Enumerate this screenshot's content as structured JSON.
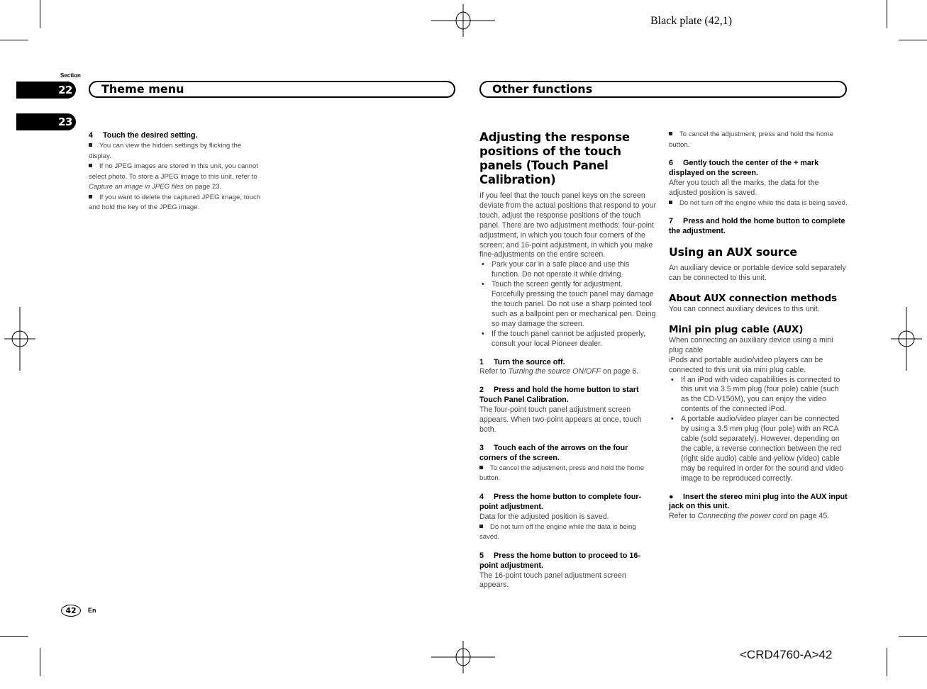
{
  "header": {
    "plate": "Black plate (42,1)"
  },
  "footer": {
    "doc_id": "<CRD4760-A>42",
    "page_number": "42",
    "language": "En"
  },
  "sections": {
    "label": "Section",
    "tabs": [
      {
        "number": "22",
        "active": true
      },
      {
        "number": "23",
        "active": false
      }
    ]
  },
  "chapters": {
    "left": "Theme menu",
    "right": "Other functions"
  },
  "left_column": {
    "step": {
      "num": "4",
      "title": "Touch the desired setting."
    },
    "notes": [
      "You can view the hidden settings by flicking the display.",
      {
        "pre": "If no JPEG images are stored in this unit, you cannot select photo. To store a JPEG image to this unit, refer to ",
        "ref": "Capture an image in JPEG files",
        "post": " on page 23."
      },
      "If you want to delete the captured JPEG image, touch and hold the key of the JPEG image."
    ]
  },
  "middle_column": {
    "title": "Adjusting the response positions of the touch panels (Touch Panel Calibration)",
    "intro": "If you feel that the touch panel keys on the screen deviate from the actual positions that respond to your touch, adjust the response positions of the touch panel. There are two adjustment methods: four-point adjustment, in which you touch four corners of the screen; and 16-point adjustment, in which you make fine-adjustments on the entire screen.",
    "bullets": [
      "Park your car in a safe place and use this function. Do not operate it while driving.",
      "Touch the screen gently for adjustment. Forcefully pressing the touch panel may damage the touch panel. Do not use a sharp pointed tool such as a ballpoint pen or mechanical pen. Doing so may damage the screen.",
      "If the touch panel cannot be adjusted properly, consult your local Pioneer dealer."
    ],
    "steps": [
      {
        "num": "1",
        "title": "Turn the source off.",
        "ref_pre": "Refer to ",
        "ref": "Turning the source ON/OFF",
        "ref_post": " on page 6."
      },
      {
        "num": "2",
        "title": "Press and hold the home button to start Touch Panel Calibration.",
        "body": "The four-point touch panel adjustment screen appears. When two-point appears at once, touch both."
      },
      {
        "num": "3",
        "title": "Touch each of the arrows on the four corners of the screen.",
        "note": "To cancel the adjustment, press and hold the home button."
      },
      {
        "num": "4",
        "title": "Press the home button to complete four-point adjustment.",
        "body": "Data for the adjusted position is saved.",
        "note": "Do not turn off the engine while the data is being saved."
      },
      {
        "num": "5",
        "title": "Press the home button to proceed to 16-point adjustment.",
        "body": "The 16-point touch panel adjustment screen appears."
      }
    ]
  },
  "right_column": {
    "top_note": "To cancel the adjustment, press and hold the home button.",
    "steps": [
      {
        "num": "6",
        "title": "Gently touch the center of the + mark displayed on the screen.",
        "body": "After you touch all the marks, the data for the adjusted position is saved.",
        "note": "Do not turn off the engine while the data is being saved."
      },
      {
        "num": "7",
        "title": "Press and hold the home button to complete the adjustment."
      }
    ],
    "aux": {
      "title": "Using an AUX source",
      "intro": "An auxiliary device or portable device sold separately can be connected to this unit.",
      "methods_title": "About AUX connection methods",
      "methods_body": "You can connect auxiliary devices to this unit.",
      "cable_title": "Mini pin plug cable (AUX)",
      "cable_body_1": "When connecting an auxiliary device using a mini plug cable",
      "cable_body_2": "iPods and portable audio/video players can be connected to this unit via mini plug cable.",
      "bullets": [
        "If an iPod with video capabilities is connected to this unit via 3.5 mm plug (four pole) cable (such as the CD-V150M), you can enjoy the video contents of the connected iPod.",
        "A portable audio/video player can be connected by using a 3.5 mm plug (four pole) with an RCA cable (sold separately). However, depending on the cable, a reverse connection between the red (right side audio) cable and yellow (video) cable may be required in order for the sound and video image to be reproduced correctly."
      ],
      "final_step": {
        "marker": "●",
        "title": "Insert the stereo mini plug into the AUX input jack on this unit.",
        "ref_pre": "Refer to ",
        "ref": "Connecting the power cord",
        "ref_post": " on page 45."
      }
    }
  }
}
